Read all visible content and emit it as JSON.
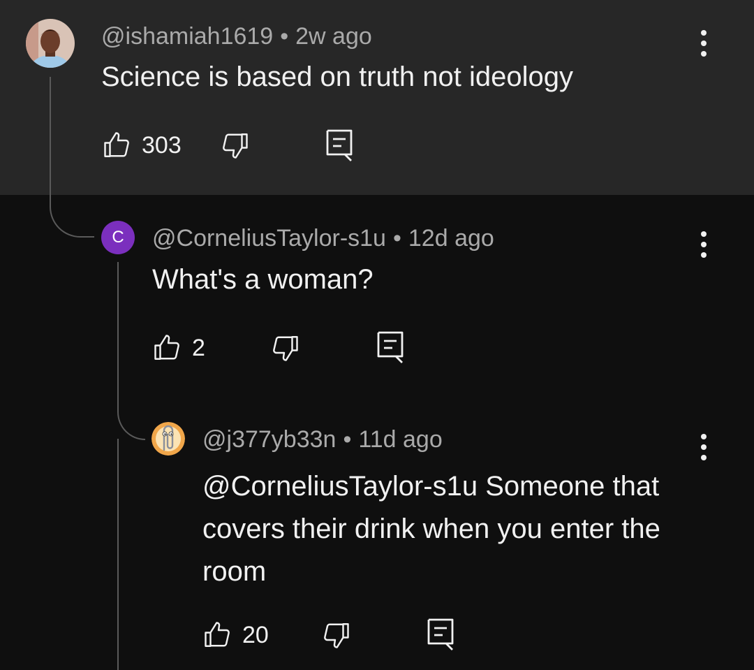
{
  "comments": [
    {
      "handle": "@ishamiah1619",
      "time": "2w ago",
      "text": "Science is based on truth not ideology",
      "likes": "303"
    },
    {
      "avatar_letter": "C",
      "handle": "@CorneliusTaylor-s1u",
      "time": "12d ago",
      "text": "What's a woman?",
      "likes": "2"
    },
    {
      "handle": "@j377yb33n",
      "time": "11d ago",
      "text": "@CorneliusTaylor-s1u Someone that covers their drink when you enter the room",
      "likes": "20"
    }
  ],
  "separator": "•",
  "icons": [
    "like-icon",
    "dislike-icon",
    "reply-icon",
    "more-vert-icon"
  ],
  "colors": {
    "top_band": "#272727",
    "background": "#0f0f0f",
    "avatar_letter_bg": "#7b2fbe",
    "meta_text": "#aaaaaa"
  }
}
